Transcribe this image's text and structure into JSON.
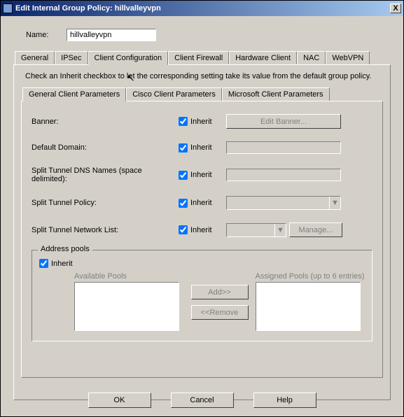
{
  "titlebar": {
    "title": "Edit Internal Group Policy: hillvalleyvpn",
    "close": "X"
  },
  "name": {
    "label": "Name:",
    "value": "hillvalleyvpn"
  },
  "tabs": {
    "general": "General",
    "ipsec": "IPSec",
    "clientconfig": "Client Configuration",
    "clientfirewall": "Client Firewall",
    "hwclient": "Hardware Client",
    "nac": "NAC",
    "webvpn": "WebVPN"
  },
  "hint": "Check an Inherit checkbox to let the corresponding setting take its value from the default group policy.",
  "subtabs": {
    "general": "General Client Parameters",
    "cisco": "Cisco Client Parameters",
    "microsoft": "Microsoft Client Parameters"
  },
  "rows": {
    "banner": {
      "label": "Banner:",
      "inherit": "Inherit",
      "button": "Edit Banner..."
    },
    "defaultDomain": {
      "label": "Default Domain:",
      "inherit": "Inherit"
    },
    "splitDns": {
      "label": "Split Tunnel DNS Names (space delimited):",
      "inherit": "Inherit"
    },
    "splitPolicy": {
      "label": "Split Tunnel Policy:",
      "inherit": "Inherit"
    },
    "splitNetList": {
      "label": "Split Tunnel Network List:",
      "inherit": "Inherit",
      "manage": "Manage..."
    }
  },
  "pools": {
    "legend": "Address pools",
    "inherit": "Inherit",
    "available": "Available Pools",
    "assigned": "Assigned Pools (up to 6 entries)",
    "add": "Add>>",
    "remove": "<<Remove"
  },
  "dialog": {
    "ok": "OK",
    "cancel": "Cancel",
    "help": "Help"
  }
}
